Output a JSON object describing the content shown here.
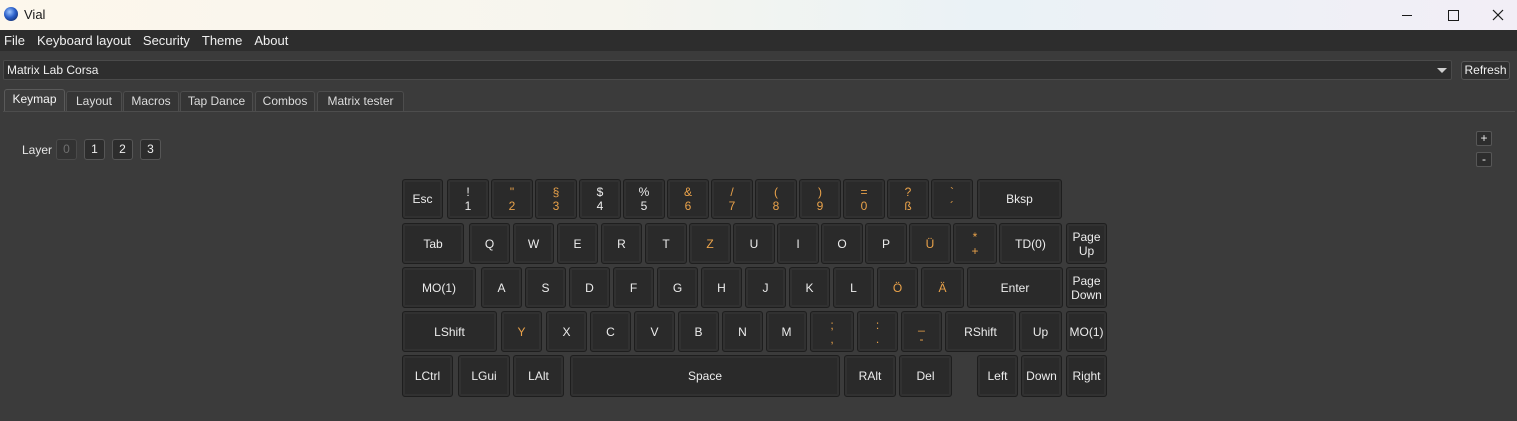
{
  "window": {
    "title": "Vial",
    "icon": "vial-logo-icon"
  },
  "menu": [
    "File",
    "Keyboard layout",
    "Security",
    "Theme",
    "About"
  ],
  "keyboard_select": {
    "value": "Matrix Lab Corsa"
  },
  "refresh_label": "Refresh",
  "tabs": [
    "Keymap",
    "Layout",
    "Macros",
    "Tap Dance",
    "Combos",
    "Matrix tester"
  ],
  "active_tab": "Keymap",
  "layer": {
    "label": "Layer",
    "buttons": [
      "0",
      "1",
      "2",
      "3"
    ],
    "current": "0"
  },
  "zoom_controls": {
    "plus": "+",
    "minus": "-"
  },
  "colors": {
    "background": "#3b3b3b",
    "key_face": "#2a2a2a",
    "non_us_key_legend": "#e9a24a",
    "text": "#ececec"
  },
  "keys": {
    "r0": [
      {
        "legend": "Esc"
      },
      {
        "top": "!",
        "bottom": "1"
      },
      {
        "top": "\"",
        "bottom": "2",
        "alt": true
      },
      {
        "top": "§",
        "bottom": "3",
        "alt": true
      },
      {
        "top": "$",
        "bottom": "4"
      },
      {
        "top": "%",
        "bottom": "5"
      },
      {
        "top": "&",
        "bottom": "6",
        "alt": true
      },
      {
        "top": "/",
        "bottom": "7",
        "alt": true
      },
      {
        "top": "(",
        "bottom": "8",
        "alt": true
      },
      {
        "top": ")",
        "bottom": "9",
        "alt": true
      },
      {
        "top": "=",
        "bottom": "0",
        "alt": true
      },
      {
        "top": "?",
        "bottom": "ß",
        "alt": true
      },
      {
        "top": "`",
        "bottom": "´",
        "alt": true
      },
      {
        "legend": "Bksp"
      }
    ],
    "r1": [
      {
        "legend": "Tab"
      },
      {
        "legend": "Q"
      },
      {
        "legend": "W"
      },
      {
        "legend": "E"
      },
      {
        "legend": "R"
      },
      {
        "legend": "T"
      },
      {
        "legend": "Z",
        "alt": true
      },
      {
        "legend": "U"
      },
      {
        "legend": "I"
      },
      {
        "legend": "O"
      },
      {
        "legend": "P"
      },
      {
        "legend": "Ü",
        "alt": true
      },
      {
        "top": "*",
        "bottom": "+",
        "alt": true
      },
      {
        "legend": "TD(0)"
      },
      {
        "top": "Page",
        "bottom": "Up"
      }
    ],
    "r2": [
      {
        "legend": "MO(1)"
      },
      {
        "legend": "A"
      },
      {
        "legend": "S"
      },
      {
        "legend": "D"
      },
      {
        "legend": "F"
      },
      {
        "legend": "G"
      },
      {
        "legend": "H"
      },
      {
        "legend": "J"
      },
      {
        "legend": "K"
      },
      {
        "legend": "L"
      },
      {
        "legend": "Ö",
        "alt": true
      },
      {
        "legend": "Ä",
        "alt": true
      },
      {
        "legend": "Enter"
      },
      {
        "top": "Page",
        "bottom": "Down"
      }
    ],
    "r3": [
      {
        "legend": "LShift"
      },
      {
        "legend": "Y",
        "alt": true
      },
      {
        "legend": "X"
      },
      {
        "legend": "C"
      },
      {
        "legend": "V"
      },
      {
        "legend": "B"
      },
      {
        "legend": "N"
      },
      {
        "legend": "M"
      },
      {
        "top": ";",
        "bottom": ",",
        "alt": true
      },
      {
        "top": ":",
        "bottom": ".",
        "alt": true
      },
      {
        "top": "_",
        "bottom": "-",
        "alt": true
      },
      {
        "legend": "RShift"
      },
      {
        "legend": "Up"
      },
      {
        "legend": "MO(1)"
      }
    ],
    "r4": [
      {
        "legend": "LCtrl"
      },
      {
        "legend": "LGui"
      },
      {
        "legend": "LAlt"
      },
      {
        "legend": "Space"
      },
      {
        "legend": "RAlt"
      },
      {
        "legend": "Del"
      },
      {
        "legend": "Left"
      },
      {
        "legend": "Down"
      },
      {
        "legend": "Right"
      }
    ]
  }
}
